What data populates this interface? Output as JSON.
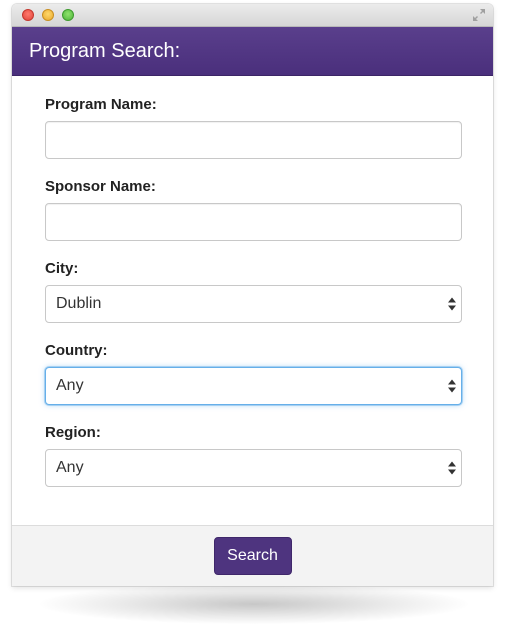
{
  "window": {
    "title_bar_buttons": [
      "close",
      "minimize",
      "zoom"
    ],
    "fullscreen_icon": "fullscreen-arrows-icon"
  },
  "header": {
    "title": "Program Search:",
    "background_color": "#4e347f"
  },
  "form": {
    "program_name": {
      "label": "Program Name:",
      "value": ""
    },
    "sponsor_name": {
      "label": "Sponsor Name:",
      "value": ""
    },
    "city": {
      "label": "City:",
      "selected": "Dublin"
    },
    "country": {
      "label": "Country:",
      "selected": "Any"
    },
    "region": {
      "label": "Region:",
      "selected": "Any"
    }
  },
  "footer": {
    "search_label": "Search",
    "button_color": "#4e347f"
  },
  "colors": {
    "accent": "#4e347f",
    "focus_ring": "#66afe9"
  }
}
